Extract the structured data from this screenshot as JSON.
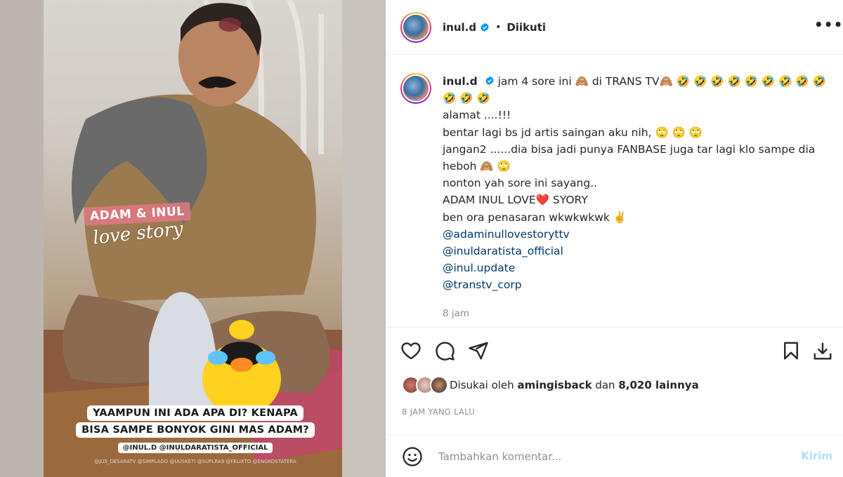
{
  "post": {
    "username": "inul.d",
    "separator": "•",
    "follow_status": "Diikuti",
    "more_label": "•••",
    "caption_lines": [
      "jam 4 sore ini 🙈 di TRANS TV🙈 🤣 🤣 🤣 🤣 🤣 🤣 🤣 🤣 🤣 🤣 🤣 🤣",
      "alamat ....!!!",
      "bentar lagi bs jd artis saingan aku nih, 🙄 🙄 🙄",
      "jangan2 ......dia bisa jadi punya FANBASE juga tar lagi klo sampe dia heboh 🙈 🙄",
      "nonton yah sore ini sayang..",
      "ADAM INUL LOVE❤️ SYORY",
      "ben ora penasaran wkwkwkwk ✌️"
    ],
    "mentions": [
      "@adaminullovestoryttv",
      "@inuldaratista_official",
      "@inul.update",
      "@transtv_corp"
    ],
    "relative_time": "8 jam",
    "likes_prefix": "Disukai oleh",
    "liked_by": "amingisback",
    "likes_joiner": "dan",
    "likes_count": "8,020 lainnya",
    "timestamp": "8 JAM YANG LALU",
    "comment_placeholder": "Tambahkan komentar...",
    "post_button": "Kirim"
  },
  "media": {
    "sticker_title": "ADAM & INUL",
    "sticker_subtitle": "love story",
    "caption_line1": "YAAMPUN INI ADA APA DI? KENAPA",
    "caption_line2": "BISA SAMPE BONYOK GINI MAS ADAM?",
    "caption_tags": "@INUL.D @INULDARATISTA_OFFICIAL",
    "caption_tiny": "@JUS_DESARATV @SIMPLADO @UUSKETI @SUPLRA9 @FELIXTO @ENGKOSTATERA"
  },
  "colors": {
    "link": "#00376b",
    "muted": "#8e8e8e",
    "post_disabled": "#b2dffc",
    "verified": "#0095f6",
    "heart": "#ed4956"
  },
  "icons": [
    "heart-icon",
    "comment-icon",
    "share-icon",
    "bookmark-icon",
    "download-icon",
    "emoji-icon",
    "verified-icon",
    "more-icon"
  ]
}
